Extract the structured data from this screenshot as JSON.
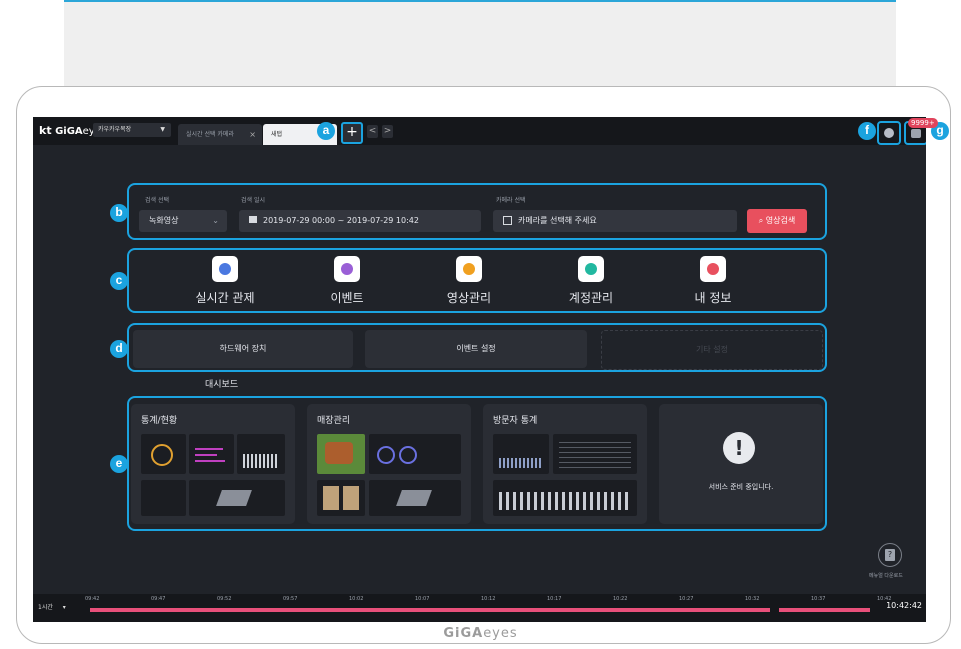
{
  "brand": {
    "kt": "kt",
    "name": "GiGA",
    "suffix": "eyes",
    "footer_name": "GiGA",
    "footer_suffix": "eyes"
  },
  "tabbar": {
    "company": "카우카우목장",
    "tabs": [
      {
        "label": "실시간 선택 카메라"
      },
      {
        "label": "새탭"
      }
    ],
    "add_label": "+",
    "prev": "<",
    "next": ">",
    "notification_count": "9999+"
  },
  "annotations": {
    "a": "a",
    "b": "b",
    "c": "c",
    "d": "d",
    "e": "e",
    "f": "f",
    "g": "g"
  },
  "search": {
    "type_label": "검색 선택",
    "type_value": "녹화영상",
    "date_label": "검색 일시",
    "date_value": "2019-07-29 00:00 ~ 2019-07-29 10:42",
    "camera_label": "카메라 선택",
    "camera_placeholder": "카메라를 선택해 주세요",
    "search_button": "영상검색"
  },
  "menu": [
    {
      "label": "실시간 관제",
      "icon": "camera-icon",
      "color": "#4a78e0"
    },
    {
      "label": "이벤트",
      "icon": "alarm-icon",
      "color": "#9a5fd6"
    },
    {
      "label": "영상관리",
      "icon": "gear-icon",
      "color": "#f0a020"
    },
    {
      "label": "계정관리",
      "icon": "account-icon",
      "color": "#22b8a0"
    },
    {
      "label": "내 정보",
      "icon": "profile-icon",
      "color": "#e8505e"
    }
  ],
  "settings": {
    "hardware": "하드웨어 장치",
    "event": "이벤트 설정",
    "other": "기타 설정"
  },
  "dashboard": {
    "title": "대시보드",
    "cards": [
      {
        "title": "통계/현황"
      },
      {
        "title": "매장관리"
      },
      {
        "title": "방문자 통계"
      },
      {
        "title": ""
      }
    ],
    "notice_icon": "!",
    "notice_text": "서비스 준비 중입니다."
  },
  "help": {
    "icon": "?",
    "label": "메뉴얼 다운로드"
  },
  "timeline": {
    "range": "1시간",
    "ticks": [
      "09:42",
      "09:47",
      "09:52",
      "09:57",
      "10:02",
      "10:07",
      "10:12",
      "10:17",
      "10:22",
      "10:27",
      "10:32",
      "10:37",
      "10:42"
    ],
    "current": "10:42:42"
  },
  "colors": {
    "accent": "#1ba3df",
    "danger": "#e8505e",
    "screen_bg": "#202329",
    "timeline_bar": "#e8507a"
  }
}
